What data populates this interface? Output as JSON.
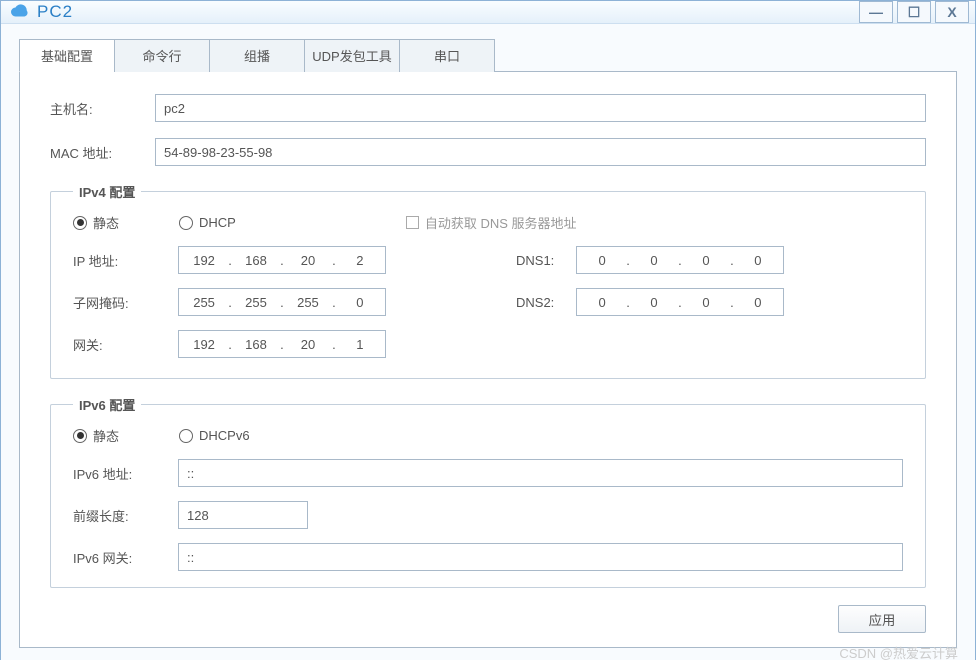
{
  "window": {
    "title": "PC2"
  },
  "tabs": [
    "基础配置",
    "命令行",
    "组播",
    "UDP发包工具",
    "串口"
  ],
  "basic": {
    "hostname_label": "主机名:",
    "hostname": "pc2",
    "mac_label": "MAC 地址:",
    "mac": "54-89-98-23-55-98"
  },
  "ipv4": {
    "legend": "IPv4 配置",
    "radio_static": "静态",
    "radio_dhcp": "DHCP",
    "checkbox_autodns": "自动获取 DNS 服务器地址",
    "ip_label": "IP 地址:",
    "ip": [
      "192",
      "168",
      "20",
      "2"
    ],
    "mask_label": "子网掩码:",
    "mask": [
      "255",
      "255",
      "255",
      "0"
    ],
    "gw_label": "网关:",
    "gw": [
      "192",
      "168",
      "20",
      "1"
    ],
    "dns1_label": "DNS1:",
    "dns1": [
      "0",
      "0",
      "0",
      "0"
    ],
    "dns2_label": "DNS2:",
    "dns2": [
      "0",
      "0",
      "0",
      "0"
    ]
  },
  "ipv6": {
    "legend": "IPv6 配置",
    "radio_static": "静态",
    "radio_dhcp": "DHCPv6",
    "addr_label": "IPv6 地址:",
    "addr": "::",
    "prefix_label": "前缀长度:",
    "prefix": "128",
    "gw_label": "IPv6 网关:",
    "gw": "::"
  },
  "footer": {
    "apply": "应用"
  },
  "watermark": "CSDN @热爱云计算"
}
